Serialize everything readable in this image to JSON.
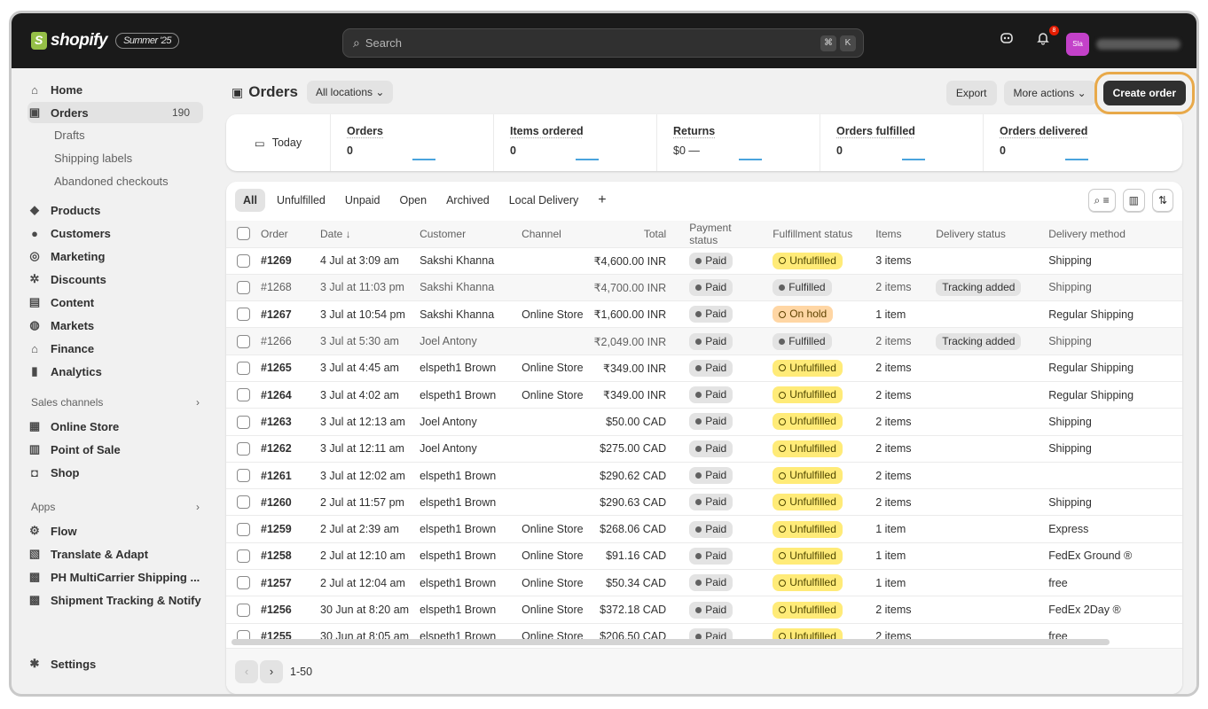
{
  "topbar": {
    "brand": "shopify",
    "edition": "Summer '25",
    "search_placeholder": "Search",
    "shortcut_cmd": "⌘",
    "shortcut_key": "K",
    "notif_count": "8",
    "avatar_initials": "Sla"
  },
  "sidebar": {
    "home": "Home",
    "orders": "Orders",
    "orders_count": "190",
    "drafts": "Drafts",
    "shipping_labels": "Shipping labels",
    "abandoned": "Abandoned checkouts",
    "products": "Products",
    "customers": "Customers",
    "marketing": "Marketing",
    "discounts": "Discounts",
    "content": "Content",
    "markets": "Markets",
    "finance": "Finance",
    "analytics": "Analytics",
    "sales_channels": "Sales channels",
    "online_store": "Online Store",
    "pos": "Point of Sale",
    "shop": "Shop",
    "apps": "Apps",
    "flow": "Flow",
    "translate": "Translate & Adapt",
    "ph_multi": "PH MultiCarrier Shipping ...",
    "shipment_tracking": "Shipment Tracking & Notify",
    "settings": "Settings"
  },
  "page": {
    "title": "Orders",
    "location_filter": "All locations",
    "export": "Export",
    "more_actions": "More actions",
    "create_order": "Create order"
  },
  "metrics": {
    "today": "Today",
    "items": [
      {
        "label": "Orders",
        "value": "0"
      },
      {
        "label": "Items ordered",
        "value": "0"
      },
      {
        "label": "Returns",
        "value": "$0 —"
      },
      {
        "label": "Orders fulfilled",
        "value": "0"
      },
      {
        "label": "Orders delivered",
        "value": "0"
      }
    ]
  },
  "tabs": [
    "All",
    "Unfulfilled",
    "Unpaid",
    "Open",
    "Archived",
    "Local Delivery"
  ],
  "columns": [
    "Order",
    "Date ↓",
    "Customer",
    "Channel",
    "Total",
    "Payment status",
    "Fulfillment status",
    "Items",
    "Delivery status",
    "Delivery method"
  ],
  "orders": [
    {
      "order": "#1269",
      "date": "4 Jul at 3:09 am",
      "customer": "Sakshi Khanna",
      "channel": "",
      "total": "₹4,600.00 INR",
      "payment": "Paid",
      "fulfillment": "Unfulfilled",
      "items": "3 items",
      "delivery_status": "",
      "method": "Shipping"
    },
    {
      "order": "#1268",
      "date": "3 Jul at 11:03 pm",
      "customer": "Sakshi Khanna",
      "channel": "",
      "total": "₹4,700.00 INR",
      "payment": "Paid",
      "fulfillment": "Fulfilled",
      "items": "2 items",
      "delivery_status": "Tracking added",
      "method": "Shipping"
    },
    {
      "order": "#1267",
      "date": "3 Jul at 10:54 pm",
      "customer": "Sakshi Khanna",
      "channel": "Online Store",
      "total": "₹1,600.00 INR",
      "payment": "Paid",
      "fulfillment": "On hold",
      "items": "1 item",
      "delivery_status": "",
      "method": "Regular Shipping"
    },
    {
      "order": "#1266",
      "date": "3 Jul at 5:30 am",
      "customer": "Joel Antony",
      "channel": "",
      "total": "₹2,049.00 INR",
      "payment": "Paid",
      "fulfillment": "Fulfilled",
      "items": "2 items",
      "delivery_status": "Tracking added",
      "method": "Shipping"
    },
    {
      "order": "#1265",
      "date": "3 Jul at 4:45 am",
      "customer": "elspeth1 Brown",
      "channel": "Online Store",
      "total": "₹349.00 INR",
      "payment": "Paid",
      "fulfillment": "Unfulfilled",
      "items": "2 items",
      "delivery_status": "",
      "method": "Regular Shipping"
    },
    {
      "order": "#1264",
      "date": "3 Jul at 4:02 am",
      "customer": "elspeth1 Brown",
      "channel": "Online Store",
      "total": "₹349.00 INR",
      "payment": "Paid",
      "fulfillment": "Unfulfilled",
      "items": "2 items",
      "delivery_status": "",
      "method": "Regular Shipping"
    },
    {
      "order": "#1263",
      "date": "3 Jul at 12:13 am",
      "customer": "Joel Antony",
      "channel": "",
      "total": "$50.00 CAD",
      "payment": "Paid",
      "fulfillment": "Unfulfilled",
      "items": "2 items",
      "delivery_status": "",
      "method": "Shipping"
    },
    {
      "order": "#1262",
      "date": "3 Jul at 12:11 am",
      "customer": "Joel Antony",
      "channel": "",
      "total": "$275.00 CAD",
      "payment": "Paid",
      "fulfillment": "Unfulfilled",
      "items": "2 items",
      "delivery_status": "",
      "method": "Shipping"
    },
    {
      "order": "#1261",
      "date": "3 Jul at 12:02 am",
      "customer": "elspeth1 Brown",
      "channel": "",
      "total": "$290.62 CAD",
      "payment": "Paid",
      "fulfillment": "Unfulfilled",
      "items": "2 items",
      "delivery_status": "",
      "method": ""
    },
    {
      "order": "#1260",
      "date": "2 Jul at 11:57 pm",
      "customer": "elspeth1 Brown",
      "channel": "",
      "total": "$290.63 CAD",
      "payment": "Paid",
      "fulfillment": "Unfulfilled",
      "items": "2 items",
      "delivery_status": "",
      "method": "Shipping"
    },
    {
      "order": "#1259",
      "date": "2 Jul at 2:39 am",
      "customer": "elspeth1 Brown",
      "channel": "Online Store",
      "total": "$268.06 CAD",
      "payment": "Paid",
      "fulfillment": "Unfulfilled",
      "items": "1 item",
      "delivery_status": "",
      "method": "Express"
    },
    {
      "order": "#1258",
      "date": "2 Jul at 12:10 am",
      "customer": "elspeth1 Brown",
      "channel": "Online Store",
      "total": "$91.16 CAD",
      "payment": "Paid",
      "fulfillment": "Unfulfilled",
      "items": "1 item",
      "delivery_status": "",
      "method": "FedEx Ground ®"
    },
    {
      "order": "#1257",
      "date": "2 Jul at 12:04 am",
      "customer": "elspeth1 Brown",
      "channel": "Online Store",
      "total": "$50.34 CAD",
      "payment": "Paid",
      "fulfillment": "Unfulfilled",
      "items": "1 item",
      "delivery_status": "",
      "method": "free"
    },
    {
      "order": "#1256",
      "date": "30 Jun at 8:20 am",
      "customer": "elspeth1 Brown",
      "channel": "Online Store",
      "total": "$372.18 CAD",
      "payment": "Paid",
      "fulfillment": "Unfulfilled",
      "items": "2 items",
      "delivery_status": "",
      "method": "FedEx 2Day ®"
    },
    {
      "order": "#1255",
      "date": "30 Jun at 8:05 am",
      "customer": "elspeth1 Brown",
      "channel": "Online Store",
      "total": "$206.50 CAD",
      "payment": "Paid",
      "fulfillment": "Unfulfilled",
      "items": "2 items",
      "delivery_status": "",
      "method": "free"
    }
  ],
  "pagination": {
    "label": "1-50"
  },
  "colors": {
    "accent_arrow": "#e8a94a",
    "unfulfilled": "#ffeb78",
    "on_hold": "#ffd6a4"
  }
}
